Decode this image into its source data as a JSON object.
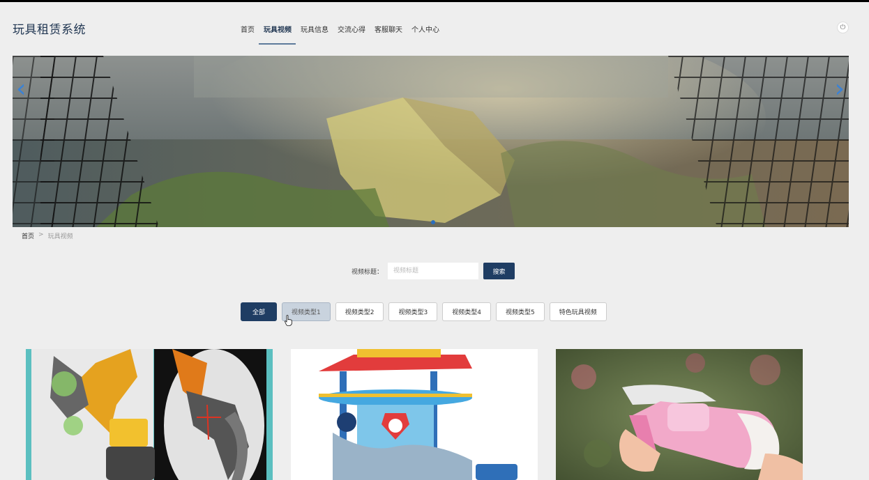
{
  "app": {
    "title": "玩具租赁系统"
  },
  "nav": {
    "items": [
      {
        "label": "首页"
      },
      {
        "label": "玩具视频"
      },
      {
        "label": "玩具信息"
      },
      {
        "label": "交流心得"
      },
      {
        "label": "客服聊天"
      },
      {
        "label": "个人中心"
      }
    ],
    "active_index": 1,
    "logout_icon": "power-icon"
  },
  "banner": {
    "prev_icon": "chevron-left-icon",
    "next_icon": "chevron-right-icon"
  },
  "breadcrumb": {
    "home": "首页",
    "separator": ">",
    "current": "玩具视频"
  },
  "search": {
    "label": "视频标题：",
    "placeholder": "视频标题",
    "value": "",
    "button": "搜索"
  },
  "categories": [
    {
      "label": "全部"
    },
    {
      "label": "视频类型1"
    },
    {
      "label": "视频类型2"
    },
    {
      "label": "视频类型3"
    },
    {
      "label": "视频类型4"
    },
    {
      "label": "视频类型5"
    },
    {
      "label": "特色玩具视频"
    }
  ],
  "categories_active_index": 0,
  "categories_hover_index": 1,
  "colors": {
    "primary": "#1f3d63",
    "accent_blue": "#3a82d6",
    "background": "#eeeeee"
  }
}
